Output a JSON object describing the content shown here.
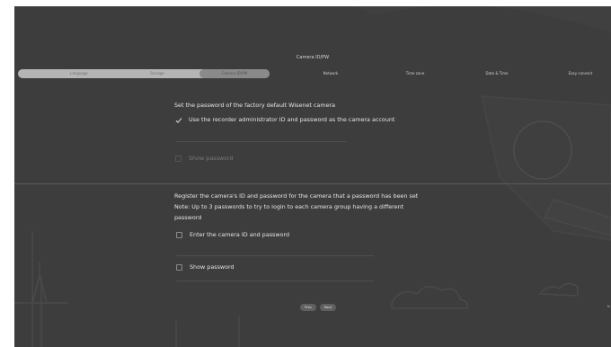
{
  "screen": {
    "title": "Camera ID/PW"
  },
  "stepper": {
    "steps": [
      {
        "label": "Language",
        "state": "done"
      },
      {
        "label": "Storage",
        "state": "done"
      },
      {
        "label": "Camera ID/PW",
        "state": "current"
      },
      {
        "label": "Network",
        "state": "pending"
      },
      {
        "label": "Time zone",
        "state": "pending"
      },
      {
        "label": "Date & Time",
        "state": "pending"
      },
      {
        "label": "Easy connect",
        "state": "pending"
      }
    ]
  },
  "section1": {
    "heading": "Set the password of the factory default Wisenet camera",
    "use_admin_checkbox_label": "Use the recorder administrator ID and password as the camera account",
    "use_admin_checked": true,
    "show_password_label": "Show password",
    "show_password_checked": false
  },
  "section2": {
    "line1": "Register the camera's ID and password for the camera that a password has been set",
    "line2": "Note: Up to 3 passwords to try to login to each camera group having a different",
    "line3": "password",
    "enter_id_label": "Enter the camera ID and password",
    "enter_id_checked": false,
    "show_password_label": "Show password",
    "show_password_checked": false
  },
  "footer": {
    "prev_label": "Prev",
    "next_label": "Next",
    "right_label": "N"
  },
  "colors": {
    "background": "#3d3d3d",
    "text": "#e6e6e6",
    "stepper_done": "#b5b5b5",
    "stepper_current": "#8a8a8a"
  }
}
